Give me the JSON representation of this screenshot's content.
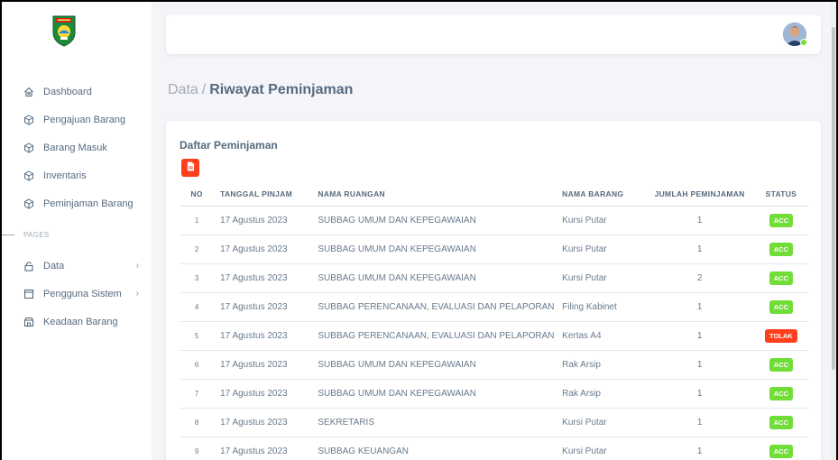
{
  "sidebar": {
    "items": [
      {
        "label": "Dashboard",
        "icon": "home-icon"
      },
      {
        "label": "Pengajuan Barang",
        "icon": "cube-icon"
      },
      {
        "label": "Barang Masuk",
        "icon": "cube-icon"
      },
      {
        "label": "Inventaris",
        "icon": "cube-icon"
      },
      {
        "label": "Peminjaman Barang",
        "icon": "cube-icon"
      }
    ],
    "section_header": "PAGES",
    "page_items": [
      {
        "label": "Data",
        "icon": "lock-icon"
      },
      {
        "label": "Pengguna Sistem",
        "icon": "layout-icon"
      },
      {
        "label": "Keadaan Barang",
        "icon": "store-icon"
      }
    ]
  },
  "breadcrumb": {
    "parent": "Data",
    "separator": "/",
    "current": "Riwayat Peminjaman"
  },
  "card": {
    "title": "Daftar Peminjaman",
    "headers": {
      "no": "NO",
      "date": "TANGGAL PINJAM",
      "room": "NAMA RUANGAN",
      "item": "NAMA BARANG",
      "qty": "JUMLAH PEMINJAMAN",
      "status": "STATUS"
    },
    "rows": [
      {
        "no": "1",
        "date": "17 Agustus 2023",
        "room": "SUBBAG UMUM DAN KEPEGAWAIAN",
        "item": "Kursi Putar",
        "qty": "1",
        "status": "ACC"
      },
      {
        "no": "2",
        "date": "17 Agustus 2023",
        "room": "SUBBAG UMUM DAN KEPEGAWAIAN",
        "item": "Kursi Putar",
        "qty": "1",
        "status": "ACC"
      },
      {
        "no": "3",
        "date": "17 Agustus 2023",
        "room": "SUBBAG UMUM DAN KEPEGAWAIAN",
        "item": "Kursi Putar",
        "qty": "2",
        "status": "ACC"
      },
      {
        "no": "4",
        "date": "17 Agustus 2023",
        "room": "SUBBAG PERENCANAAN, EVALUASI DAN PELAPORAN",
        "item": "Filing Kabinet",
        "qty": "1",
        "status": "ACC"
      },
      {
        "no": "5",
        "date": "17 Agustus 2023",
        "room": "SUBBAG PERENCANAAN, EVALUASI DAN PELAPORAN",
        "item": "Kertas A4",
        "qty": "1",
        "status": "TOLAK"
      },
      {
        "no": "6",
        "date": "17 Agustus 2023",
        "room": "SUBBAG UMUM DAN KEPEGAWAIAN",
        "item": "Rak Arsip",
        "qty": "1",
        "status": "ACC"
      },
      {
        "no": "7",
        "date": "17 Agustus 2023",
        "room": "SUBBAG UMUM DAN KEPEGAWAIAN",
        "item": "Rak Arsip",
        "qty": "1",
        "status": "ACC"
      },
      {
        "no": "8",
        "date": "17 Agustus 2023",
        "room": "SEKRETARIS",
        "item": "Kursi Putar",
        "qty": "1",
        "status": "ACC"
      },
      {
        "no": "9",
        "date": "17 Agustus 2023",
        "room": "SUBBAG KEUANGAN",
        "item": "Kursi Putar",
        "qty": "1",
        "status": "ACC"
      }
    ]
  },
  "colors": {
    "acc": "#71dd37",
    "tolak": "#ff3e1d",
    "text": "#697a8d",
    "heading": "#566a7f"
  }
}
